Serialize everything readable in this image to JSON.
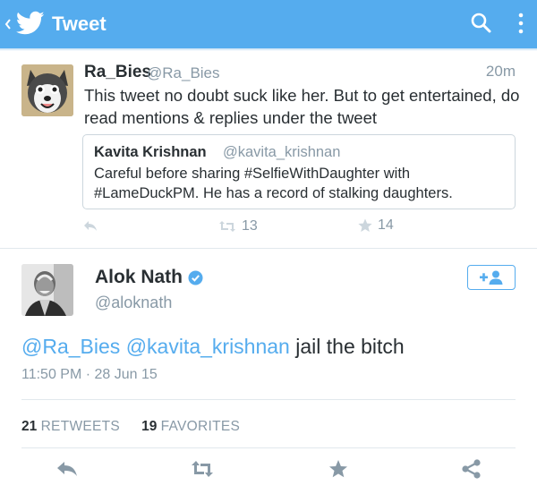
{
  "appbar": {
    "back_icon": "chevron-left-icon",
    "logo_icon": "twitter-bird-icon",
    "title": "Tweet",
    "search_icon": "search-icon",
    "more_icon": "more-vertical-icon",
    "color": "#55acee"
  },
  "context_tweet": {
    "avatar": "husky-avatar",
    "name": "Ra_Bies",
    "handle": "@Ra_Bies",
    "time": "20m",
    "text": "This tweet no doubt suck like her. But to get entertained, do read mentions & replies under the tweet",
    "quoted": {
      "name": "Kavita Krishnan",
      "handle": "@kavita_krishnan",
      "text": "Careful before sharing #SelfieWithDaughter with #LameDuckPM. He has a record of stalking daughters."
    },
    "retweet_count": "13",
    "favorite_count": "14"
  },
  "main_tweet": {
    "name": "Alok Nath",
    "verified": true,
    "handle": "@aloknath",
    "follow_icon": "add-user-icon",
    "mention_1": "@Ra_Bies",
    "mention_2": "@kavita_krishnan",
    "text_rest": " jail the bitch",
    "timestamp": "11:50 PM · 28 Jun 15",
    "retweets_count": "21",
    "retweets_label": "RETWEETS",
    "favorites_count": "19",
    "favorites_label": "FAVORITES"
  },
  "action_bar": {
    "reply_icon": "reply-icon",
    "retweet_icon": "retweet-icon",
    "favorite_icon": "star-icon",
    "share_icon": "share-icon"
  },
  "colors": {
    "accent": "#55acee",
    "muted": "#8899a6",
    "text": "#292f33",
    "divider": "#e1e8ed"
  }
}
